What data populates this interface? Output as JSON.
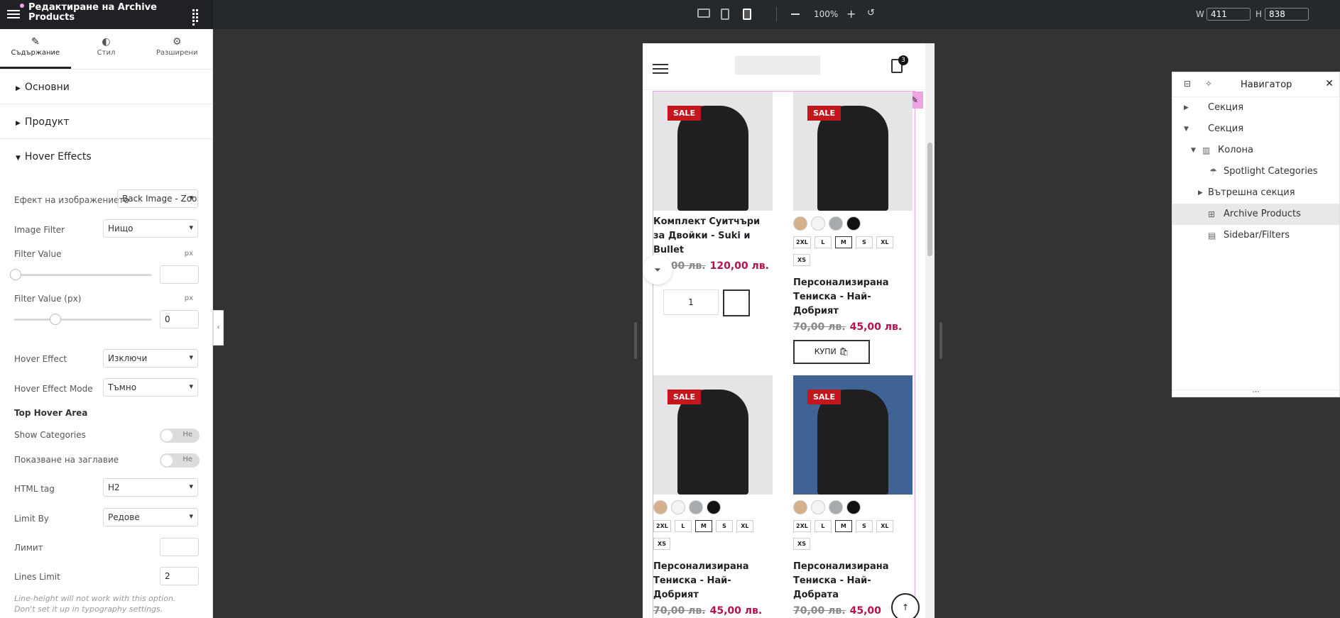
{
  "topbar": {
    "title": "Редактиране на Archive Products",
    "zoom": "100%",
    "w_label": "W",
    "h_label": "H",
    "width_value": "411",
    "height_value": "838"
  },
  "panel": {
    "tabs": [
      {
        "label": "Съдържание",
        "icon": "pencil-icon"
      },
      {
        "label": "Стил",
        "icon": "contrast-icon"
      },
      {
        "label": "Разширени",
        "icon": "gear-icon"
      }
    ],
    "sections": [
      "Основни",
      "Продукт",
      "Hover Effects"
    ],
    "controls": {
      "image_effect_label": "Ефект на изображението",
      "image_effect_value": "Back Image - Zoom",
      "image_filter_label": "Image Filter",
      "image_filter_value": "Нищо",
      "filter_value_label": "Filter Value",
      "filter_value_unit": "px",
      "filter_value_px_label": "Filter Value (px)",
      "filter_value_px_unit": "px",
      "filter_value_px": "0",
      "hover_effect_label": "Hover Effect",
      "hover_effect_value": "Изключи",
      "hover_mode_label": "Hover Effect Mode",
      "hover_mode_value": "Тъмно",
      "top_hover_heading": "Top Hover Area",
      "show_categories_label": "Show Categories",
      "show_categories_state": "Не",
      "show_title_label": "Показване на заглавие",
      "show_title_state": "Не",
      "html_tag_label": "HTML tag",
      "html_tag_value": "H2",
      "limit_by_label": "Limit By",
      "limit_by_value": "Редове",
      "limit_label": "Лимит",
      "lines_limit_label": "Lines Limit",
      "lines_limit_value": "2",
      "note": "Line-height will not work with this option. Don't set it up in typography settings."
    }
  },
  "preview": {
    "cart_count": "3",
    "sale_badge": "SALE",
    "buy_label": "КУПИ",
    "qty": "1",
    "sizes": [
      "2XL",
      "L",
      "M",
      "S",
      "XL",
      "XS"
    ],
    "swatch_colors": [
      "#d6b08c",
      "#f4f4f4",
      "#a7abae",
      "#111111"
    ],
    "products": [
      {
        "title": "Комплект Суитчъри за Двойки - Suki и Bullet",
        "old_price": "70,00 лв.",
        "new_price": "120,00 лв."
      },
      {
        "title": "Персонализирана Тениска - Най-Добрият",
        "old_price": "70,00 лв.",
        "new_price": "45,00 лв."
      },
      {
        "title": "Персонализирана Тениска - Най-Добрият",
        "old_price": "70,00 лв.",
        "new_price": "45,00 лв."
      },
      {
        "title": "Персонализирана Тениска - Най-Добрата",
        "old_price": "70,00 лв.",
        "new_price": "45,00"
      }
    ]
  },
  "navigator": {
    "title": "Навигатор",
    "items": [
      {
        "label": "Секция"
      },
      {
        "label": "Секция"
      },
      {
        "label": "Колона"
      },
      {
        "label": "Spotlight Categories"
      },
      {
        "label": "Вътрешна секция"
      },
      {
        "label": "Archive Products"
      },
      {
        "label": "Sidebar/Filters"
      }
    ]
  },
  "colors": {
    "accent": "#f0a3e5",
    "sale": "#c4161c",
    "price": "#b3124f"
  }
}
